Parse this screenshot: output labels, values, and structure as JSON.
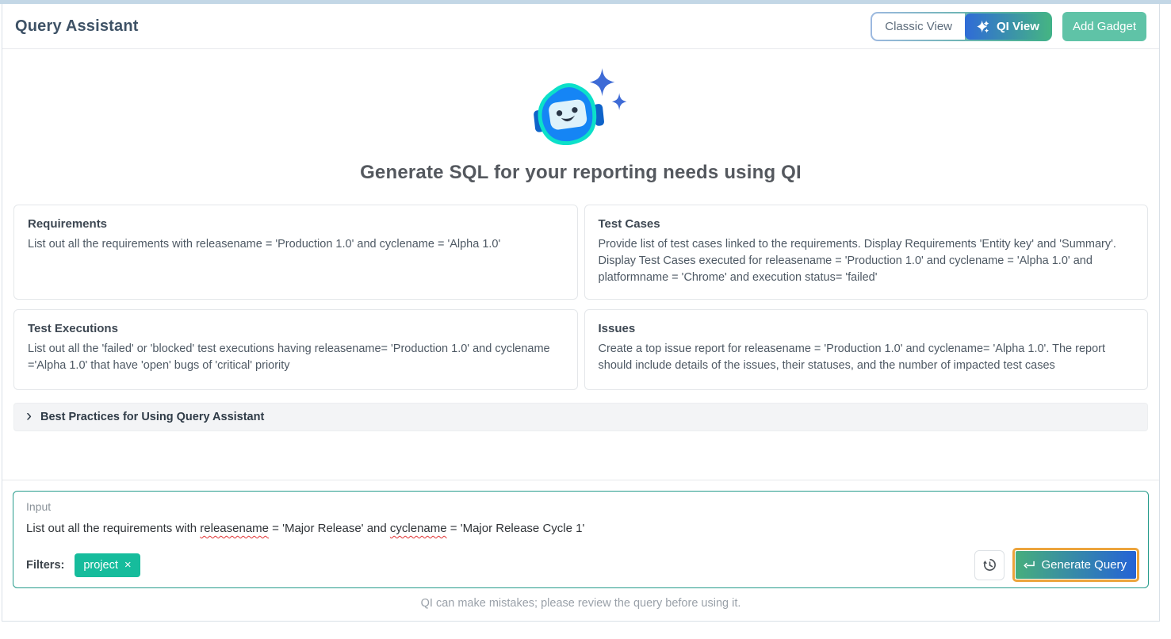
{
  "header": {
    "title": "Query Assistant",
    "view_toggle": {
      "classic_label": "Classic View",
      "qi_label": "QI View",
      "active": "QI View"
    },
    "add_gadget_label": "Add Gadget"
  },
  "hero": {
    "heading": "Generate SQL for your reporting needs using QI"
  },
  "example_cards": [
    {
      "title": "Requirements",
      "body": "List out all the requirements with releasename = 'Production 1.0' and cyclename = 'Alpha 1.0'"
    },
    {
      "title": "Test Cases",
      "body": "Provide list of test cases linked to the requirements. Display Requirements 'Entity key' and 'Summary'. Display Test Cases executed for releasename = 'Production 1.0' and cyclename = 'Alpha 1.0' and platformname = 'Chrome' and execution status= 'failed'"
    },
    {
      "title": "Test Executions",
      "body": "List out all the 'failed' or 'blocked' test executions having releasename= 'Production 1.0' and cyclename ='Alpha 1.0' that have 'open' bugs of 'critical' priority"
    },
    {
      "title": "Issues",
      "body": "Create a top issue report for releasename = 'Production 1.0' and cyclename= 'Alpha 1.0'. The report should include details of the issues, their statuses, and the number of impacted test cases"
    }
  ],
  "best_practices": {
    "label": "Best Practices for Using Query Assistant"
  },
  "input_panel": {
    "label": "Input",
    "query": {
      "prefix": "List out all the requirements with ",
      "term_1": "releasename",
      "mid": " = 'Major Release' and ",
      "term_2": "cyclename",
      "suffix": " = 'Major Release Cycle 1'"
    },
    "filters_label": "Filters:",
    "filter_chips": [
      {
        "label": "project"
      }
    ],
    "generate_button_label": "Generate Query"
  },
  "footer": {
    "disclaimer": "QI can make mistakes; please review the query before using it."
  },
  "icons": {
    "chip_close": "×",
    "bp_chevron": "›"
  },
  "colors": {
    "accent_teal": "#16bc9c",
    "input_border_teal": "#279c8c",
    "add_gadget_green": "#5fc3a7",
    "qi_gradient_start": "#2f6bd7",
    "qi_gradient_end": "#45b483",
    "generate_gradient_start": "#47ae7d",
    "generate_gradient_end": "#2563d6",
    "highlight_orange": "#eca43c",
    "top_strip_blue": "#c3d7e6",
    "spellcheck_red": "#e03131"
  }
}
